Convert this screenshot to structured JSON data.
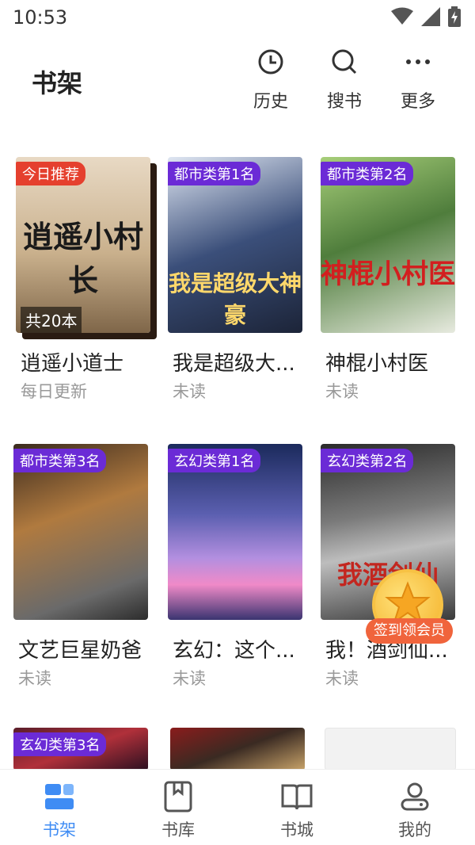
{
  "status_bar": {
    "time": "10:53",
    "icons": [
      "wifi-icon",
      "signal-icon",
      "battery-icon"
    ]
  },
  "header": {
    "title": "书架",
    "actions": [
      {
        "label": "历史",
        "icon": "clock-icon"
      },
      {
        "label": "搜书",
        "icon": "search-icon"
      },
      {
        "label": "更多",
        "icon": "more-dots-icon"
      }
    ]
  },
  "books": [
    {
      "title": "逍遥小道士",
      "subtitle": "每日更新",
      "badge": "今日推荐",
      "count": "共20本",
      "cover_text": "逍遥小村长"
    },
    {
      "title": "我是超级大...",
      "subtitle": "未读",
      "badge": "都市类第1名",
      "cover_text": "我是超级大神豪"
    },
    {
      "title": "神棍小村医",
      "subtitle": "未读",
      "badge": "都市类第2名",
      "cover_text": "神棍小村医"
    },
    {
      "title": "文艺巨星奶爸",
      "subtitle": "未读",
      "badge": "都市类第3名"
    },
    {
      "title": "玄幻：这个...",
      "subtitle": "未读",
      "badge": "玄幻类第1名"
    },
    {
      "title": "我！酒剑仙...",
      "subtitle": "未读",
      "badge": "玄幻类第2名",
      "cover_text": "我酒剑仙"
    },
    {
      "badge": "玄幻类第3名"
    }
  ],
  "checkin": {
    "label": "签到领会员"
  },
  "bottom_nav": [
    {
      "label": "书架",
      "icon": "bookshelf-icon",
      "active": true
    },
    {
      "label": "书库",
      "icon": "library-icon",
      "active": false
    },
    {
      "label": "书城",
      "icon": "bookstore-icon",
      "active": false
    },
    {
      "label": "我的",
      "icon": "profile-icon",
      "active": false
    }
  ],
  "colors": {
    "accent": "#3f8cf4",
    "badge_purple": "#6b2bd6",
    "badge_red": "#e5402e",
    "checkin": "#f0643c"
  }
}
